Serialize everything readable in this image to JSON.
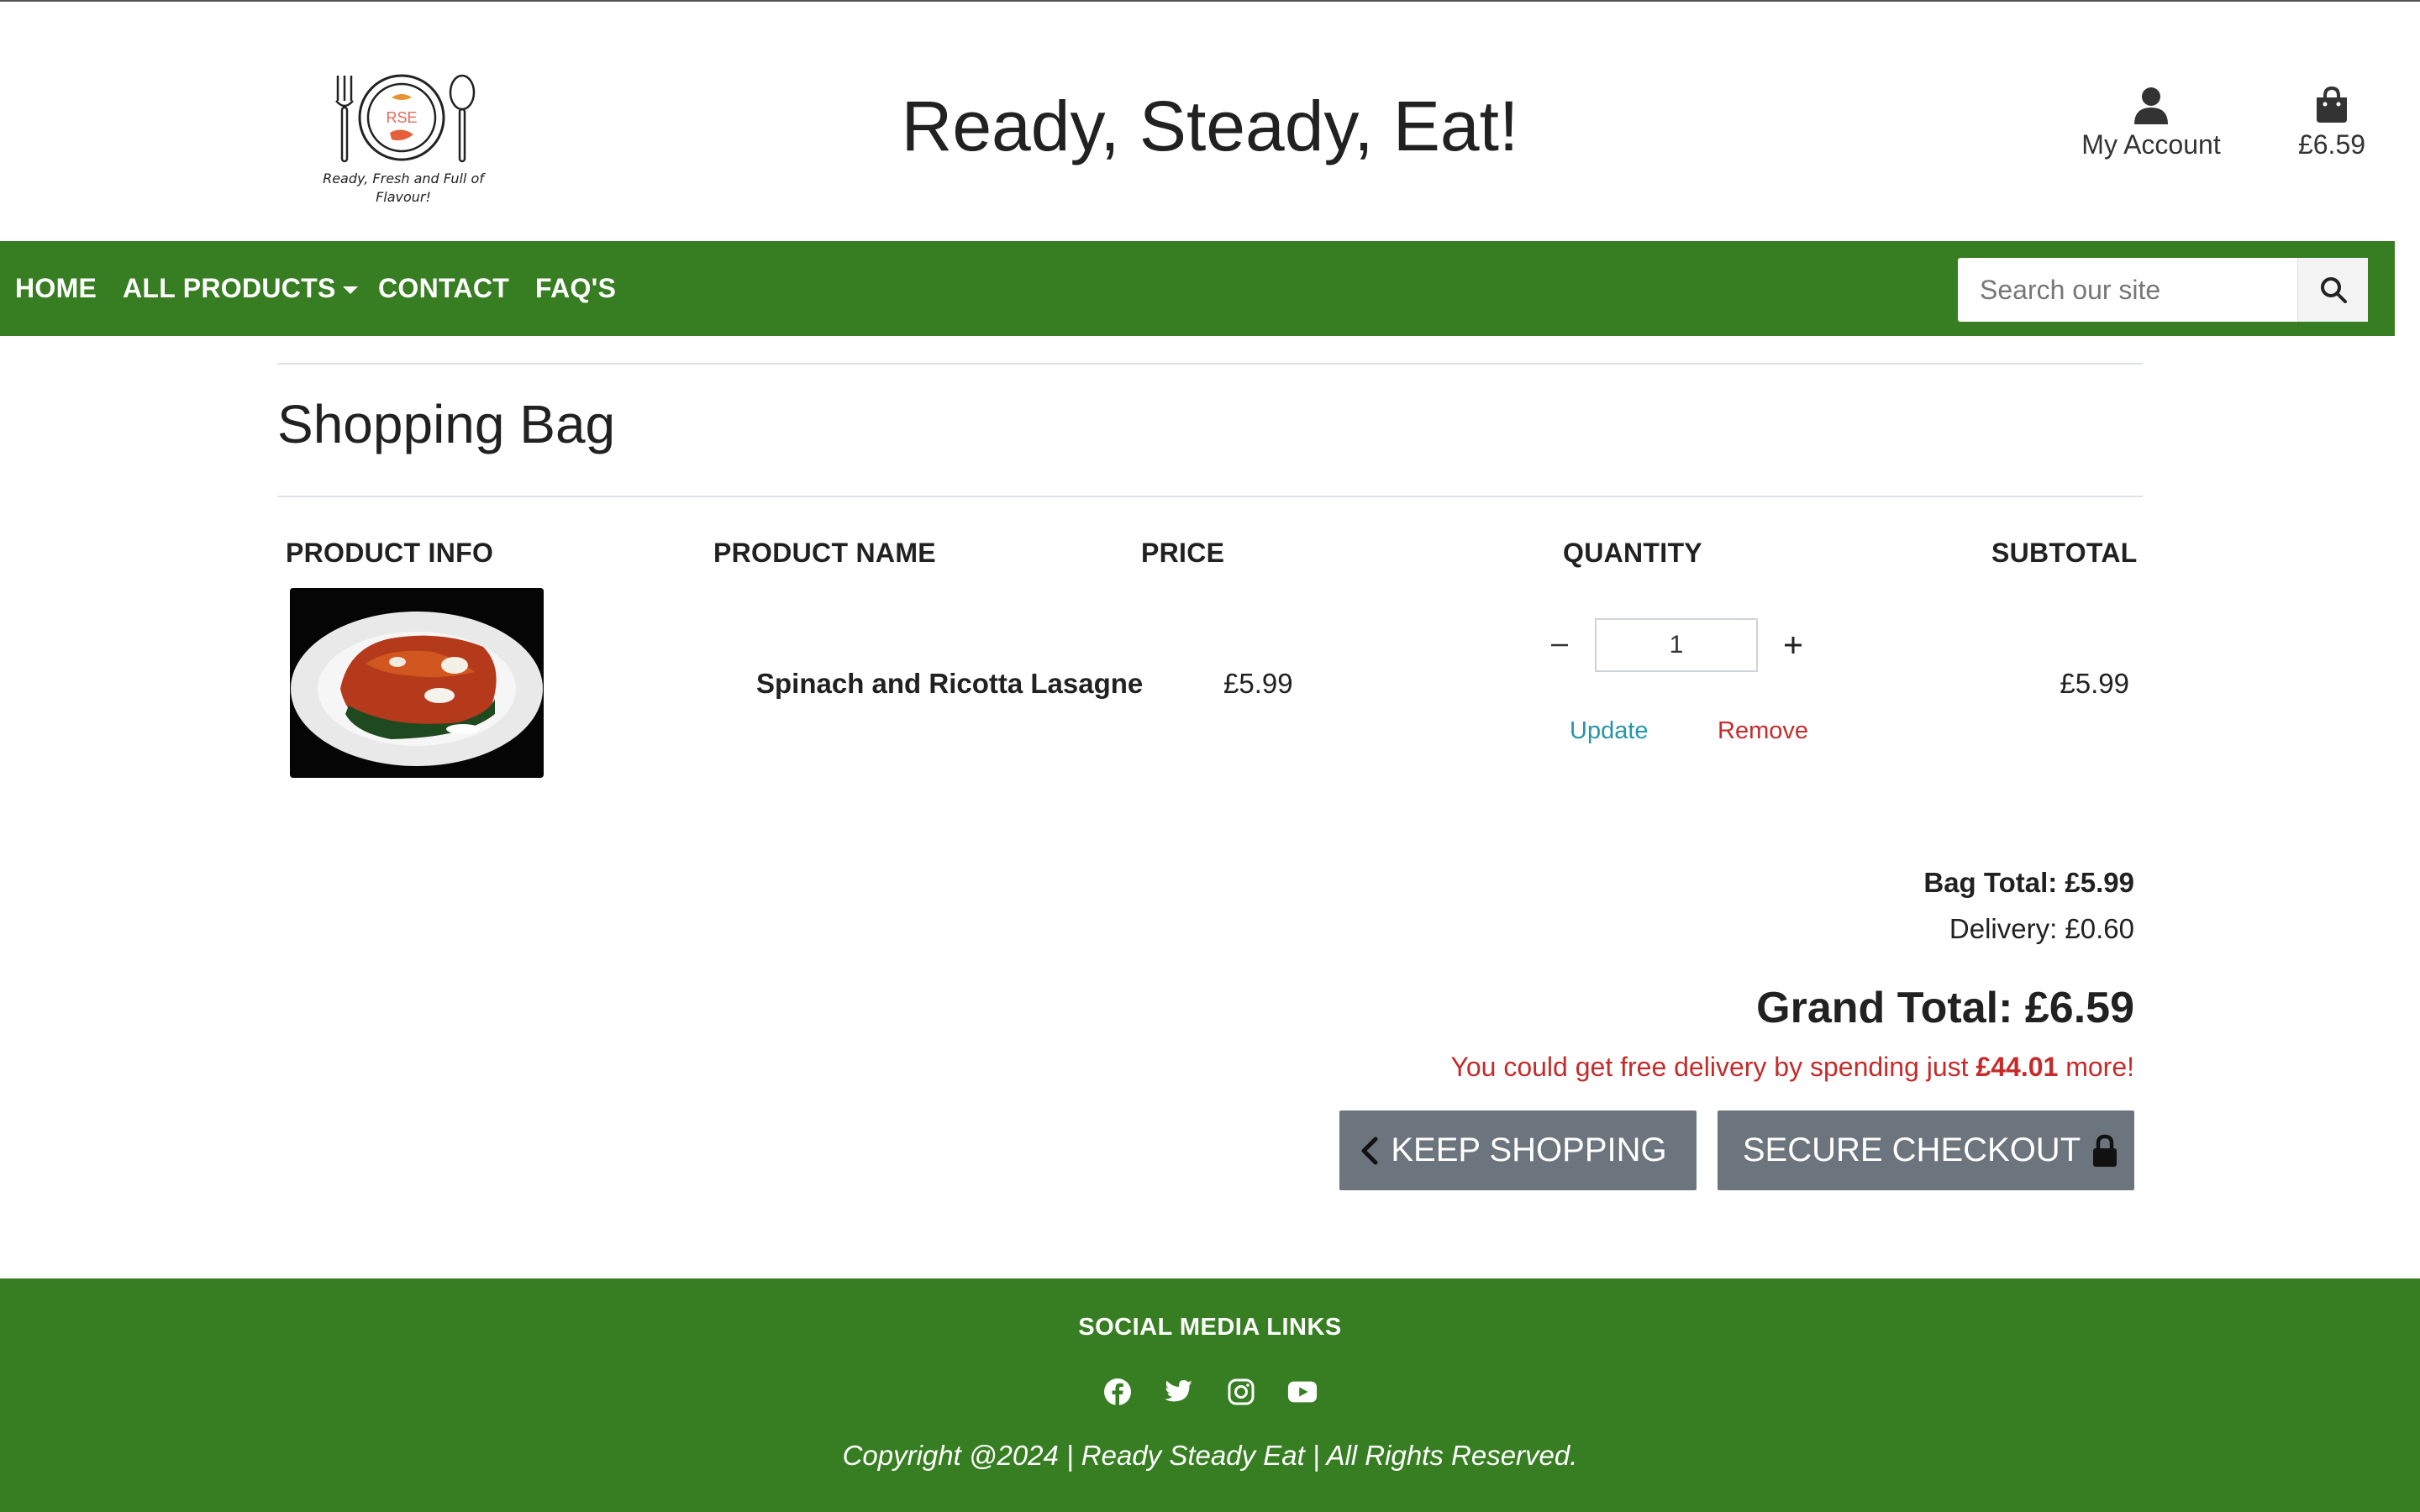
{
  "header": {
    "logo": {
      "monogram": "RSE",
      "tagline": "Ready, Fresh and Full of Flavour!",
      "icon": "plate-fork-spoon-logo"
    },
    "site_title": "Ready, Steady, Eat!",
    "account_label": "My Account",
    "bag_total": "£6.59"
  },
  "nav": {
    "items": [
      {
        "label": "HOME"
      },
      {
        "label": "ALL PRODUCTS",
        "dropdown": true
      },
      {
        "label": "CONTACT"
      },
      {
        "label": "FAQ'S"
      }
    ],
    "search_placeholder": "Search our site",
    "color": "#367e21"
  },
  "main": {
    "title": "Shopping Bag",
    "table": {
      "columns": [
        "PRODUCT INFO",
        "PRODUCT NAME",
        "PRICE",
        "QUANTITY",
        "SUBTOTAL"
      ],
      "rows": [
        {
          "image_alt": "Spinach and Ricotta Lasagne photo",
          "name": "Spinach and Ricotta Lasagne",
          "price": "£5.99",
          "quantity": "1",
          "update_label": "Update",
          "remove_label": "Remove",
          "subtotal": "£5.99"
        }
      ]
    },
    "summary": {
      "bag_total": "Bag Total: £5.99",
      "delivery": "Delivery: £0.60",
      "grand_total": "Grand Total: £6.59",
      "free_delivery_prefix": "You could get free delivery by spending just ",
      "free_delivery_amount": "£44.01",
      "free_delivery_suffix": " more!"
    },
    "buttons": {
      "keep_shopping": "KEEP SHOPPING",
      "secure_checkout": "SECURE CHECKOUT"
    }
  },
  "footer": {
    "title": "SOCIAL MEDIA LINKS",
    "socials": [
      "facebook-icon",
      "twitter-icon",
      "instagram-icon",
      "youtube-icon"
    ],
    "copyright": "Copyright @2024 | Ready Steady Eat | All Rights Reserved."
  }
}
